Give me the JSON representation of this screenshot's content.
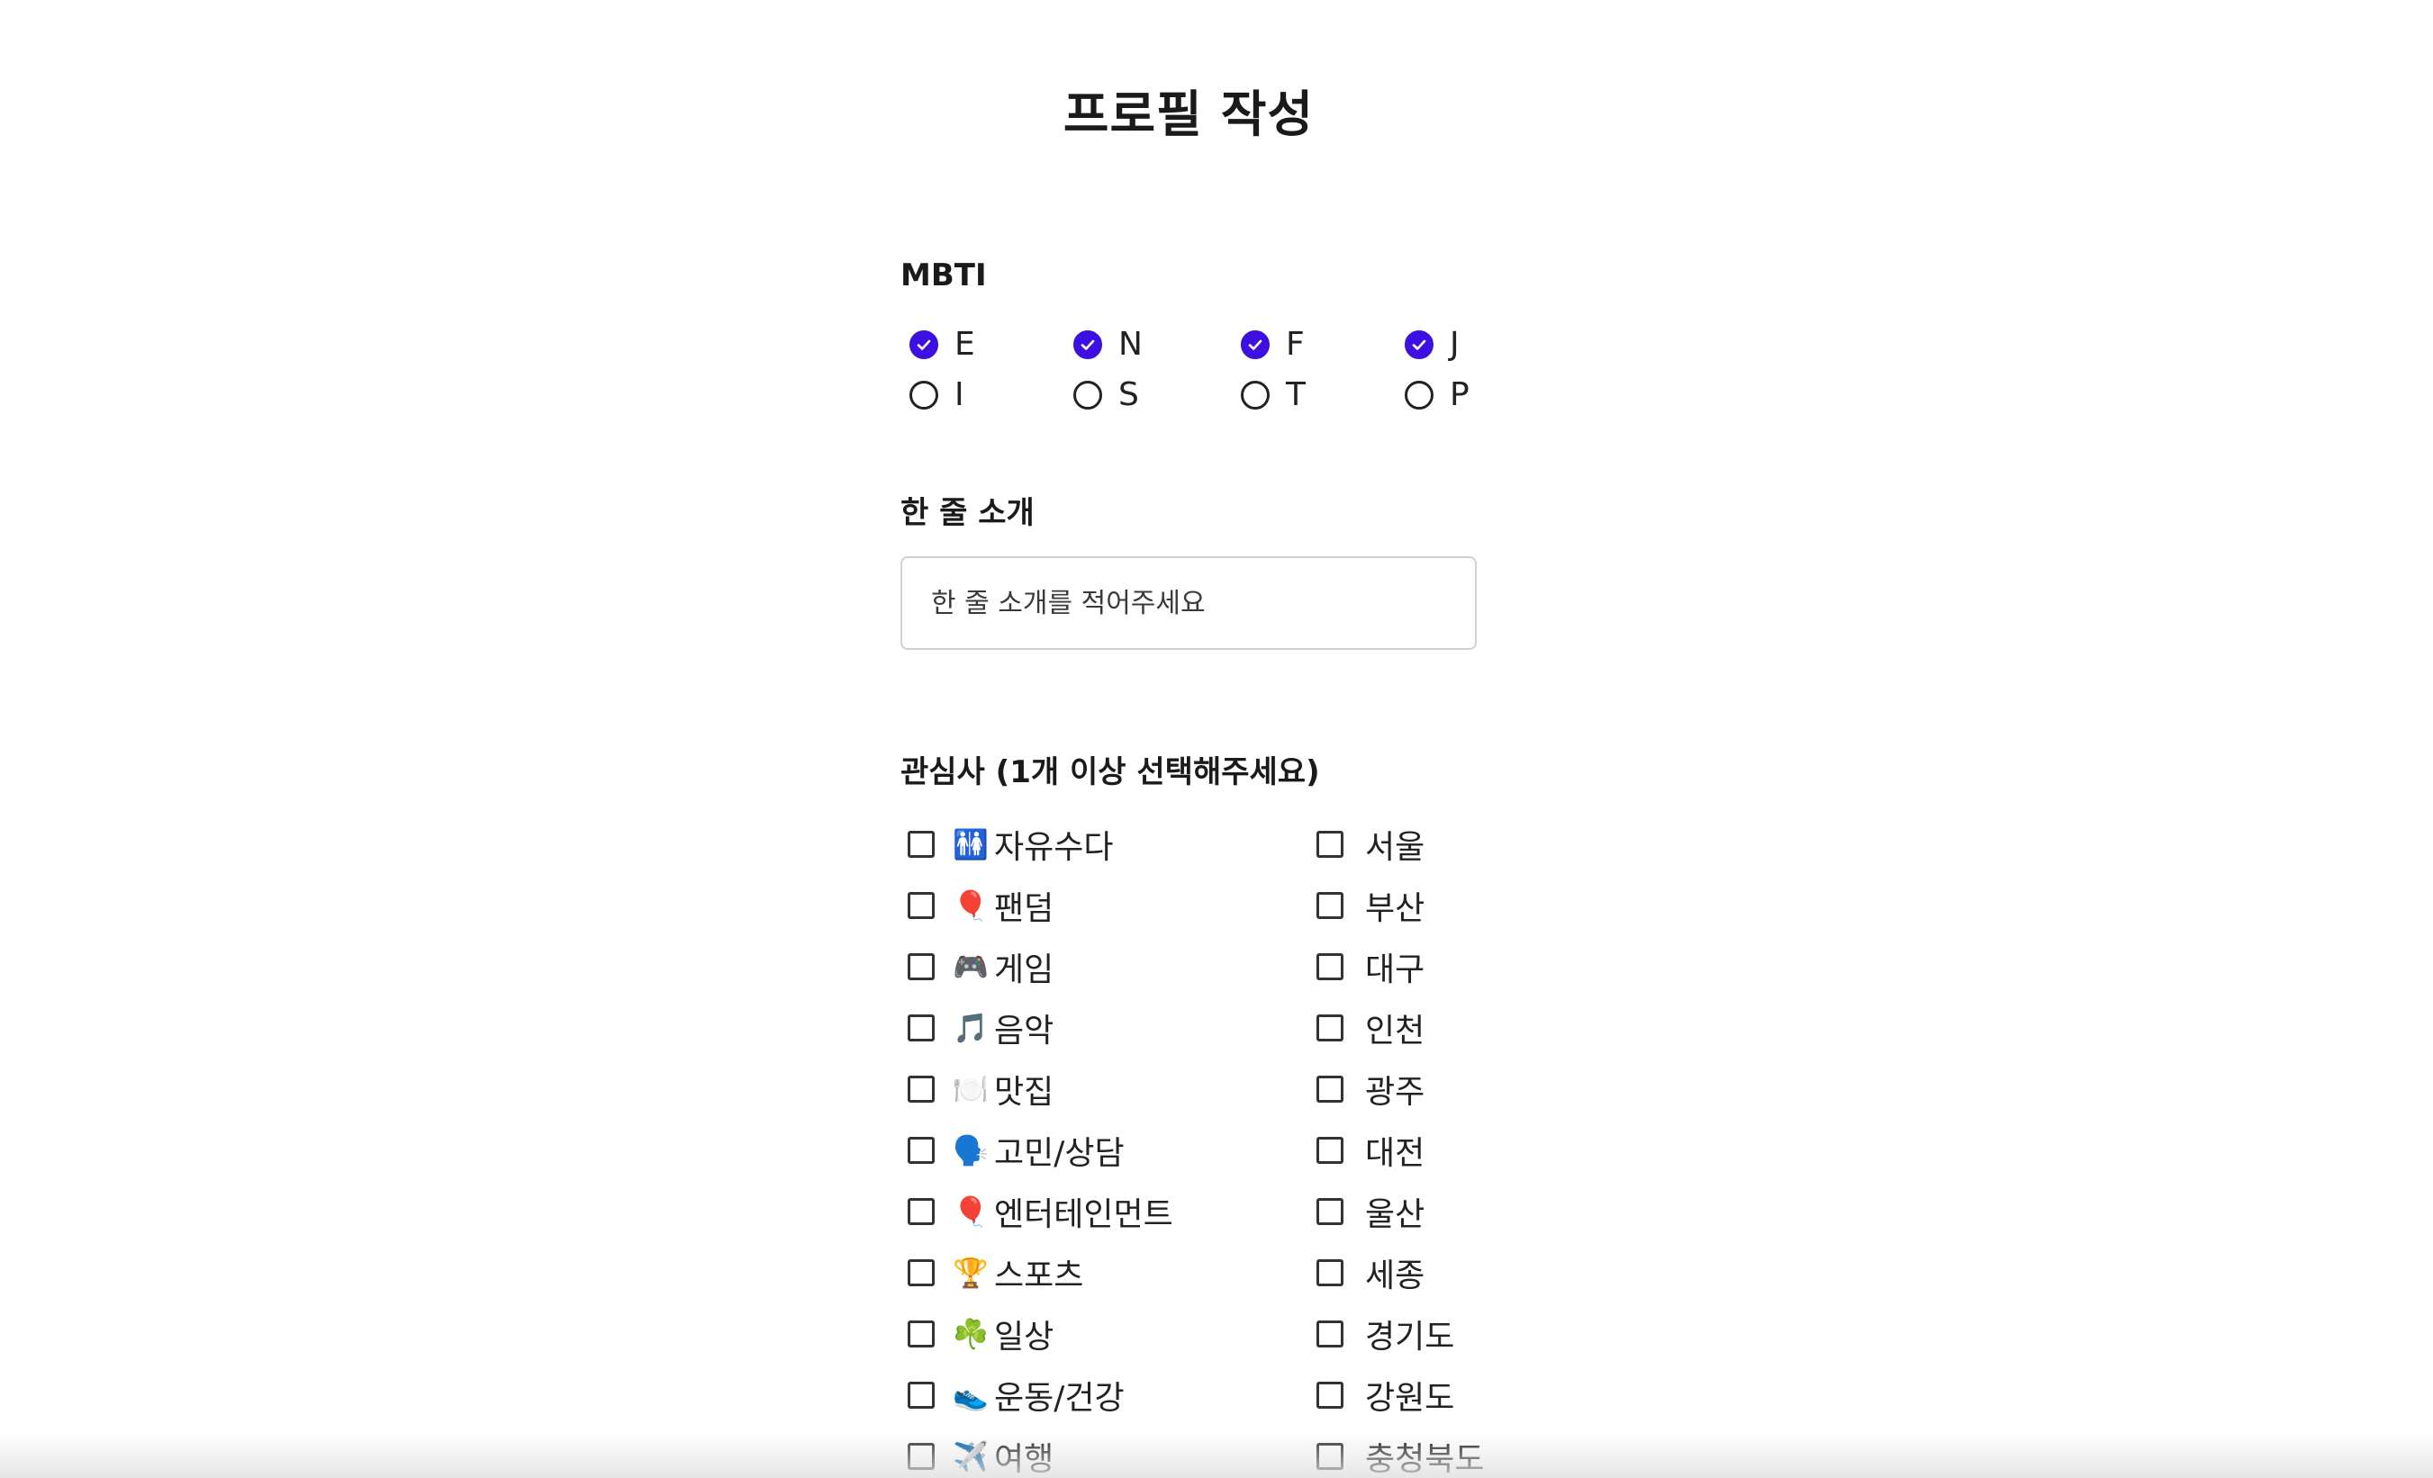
{
  "page_title": "프로필 작성",
  "mbti": {
    "label": "MBTI",
    "options": [
      {
        "letter": "E",
        "checked": true
      },
      {
        "letter": "N",
        "checked": true
      },
      {
        "letter": "F",
        "checked": true
      },
      {
        "letter": "J",
        "checked": true
      },
      {
        "letter": "I",
        "checked": false
      },
      {
        "letter": "S",
        "checked": false
      },
      {
        "letter": "T",
        "checked": false
      },
      {
        "letter": "P",
        "checked": false
      }
    ],
    "accent_color": "#3d0fe0"
  },
  "intro": {
    "label": "한 줄 소개",
    "placeholder": "한 줄 소개를 적어주세요",
    "value": ""
  },
  "interests": {
    "label": "관심사 (1개 이상 선택해주세요)",
    "topics": [
      {
        "icon": "🚻",
        "label": "자유수다",
        "checked": false
      },
      {
        "icon": "🎈",
        "label": "팬덤",
        "checked": false
      },
      {
        "icon": "🎮",
        "label": "게임",
        "checked": false
      },
      {
        "icon": "🎵",
        "label": "음악",
        "checked": false
      },
      {
        "icon": "🍽️",
        "label": "맛집",
        "checked": false
      },
      {
        "icon": "🗣️",
        "label": "고민/상담",
        "checked": false
      },
      {
        "icon": "🎈",
        "label": "엔터테인먼트",
        "checked": false
      },
      {
        "icon": "🏆",
        "label": "스포츠",
        "checked": false
      },
      {
        "icon": "☘️",
        "label": "일상",
        "checked": false
      },
      {
        "icon": "👟",
        "label": "운동/건강",
        "checked": false
      },
      {
        "icon": "✈️",
        "label": "여행",
        "checked": false
      }
    ],
    "regions": [
      {
        "label": "서울",
        "checked": false
      },
      {
        "label": "부산",
        "checked": false
      },
      {
        "label": "대구",
        "checked": false
      },
      {
        "label": "인천",
        "checked": false
      },
      {
        "label": "광주",
        "checked": false
      },
      {
        "label": "대전",
        "checked": false
      },
      {
        "label": "울산",
        "checked": false
      },
      {
        "label": "세종",
        "checked": false
      },
      {
        "label": "경기도",
        "checked": false
      },
      {
        "label": "강원도",
        "checked": false
      },
      {
        "label": "충청북도",
        "checked": false
      }
    ]
  }
}
